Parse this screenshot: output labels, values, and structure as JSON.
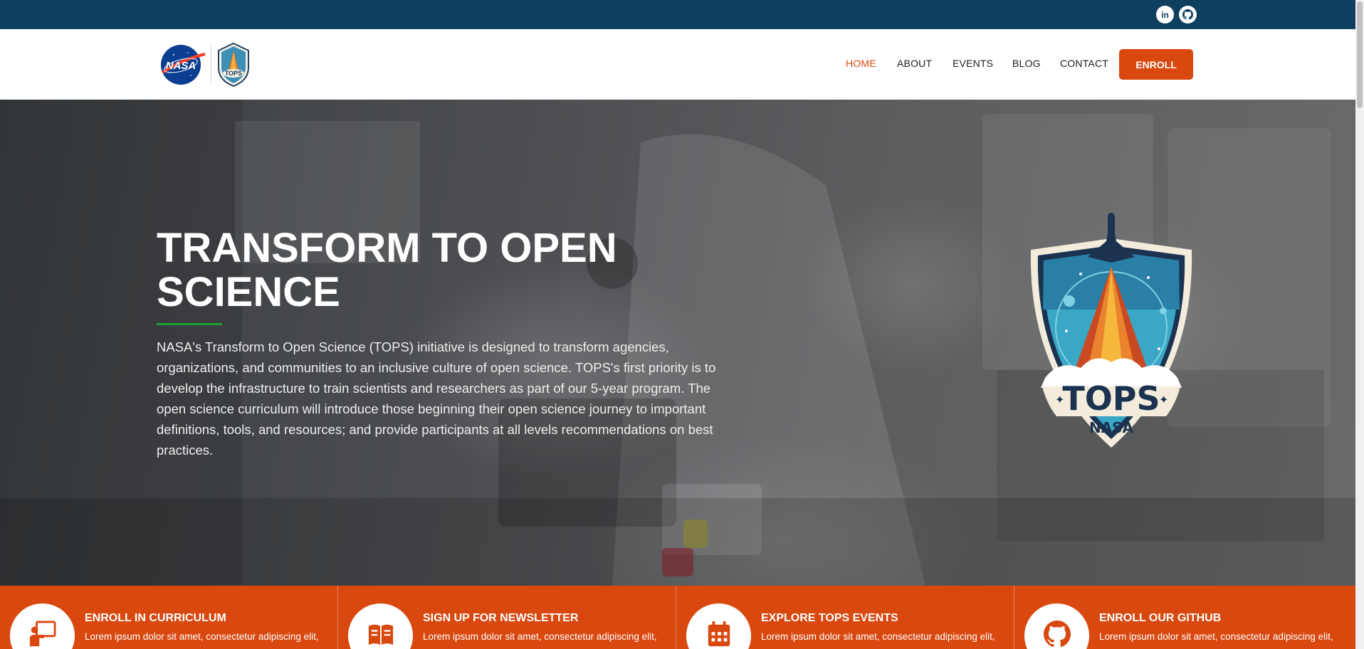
{
  "social": [
    {
      "name": "linkedin",
      "glyph": "in"
    },
    {
      "name": "github",
      "glyph": ""
    }
  ],
  "logos": {
    "nasa_text": "NASA",
    "tops_text": "TOPS"
  },
  "nav": {
    "items": [
      {
        "label": "HOME",
        "active": true
      },
      {
        "label": "ABOUT",
        "active": false
      },
      {
        "label": "EVENTS",
        "active": false
      },
      {
        "label": "BLOG",
        "active": false
      },
      {
        "label": "CONTACT",
        "active": false
      }
    ],
    "enroll_label": "ENROLL"
  },
  "hero": {
    "title": "TRANSFORM TO OPEN SCIENCE",
    "description": "NASA's Transform to Open Science (TOPS) initiative is designed to transform agencies, organizations, and communities to an inclusive culture of open science. TOPS's first priority is to develop the infrastructure to train scientists and researchers as part of our 5-year program. The open science curriculum will introduce those beginning their open science journey to important definitions, tools, and resources; and provide participants at all levels recommendations on best practices.",
    "badge_title": "TOPS",
    "badge_subtitle": "NASA"
  },
  "features": [
    {
      "title": "ENROLL IN CURRICULUM",
      "text": "Lorem ipsum dolor sit amet, consectetur adipiscing elit,",
      "icon": "teacher-icon"
    },
    {
      "title": "SIGN UP FOR NEWSLETTER",
      "text": "Lorem ipsum dolor sit amet, consectetur adipiscing elit,",
      "icon": "book-icon"
    },
    {
      "title": "EXPLORE TOPS EVENTS",
      "text": "Lorem ipsum dolor sit amet, consectetur adipiscing elit,",
      "icon": "calendar-icon"
    },
    {
      "title": "ENROLL OUR GITHUB",
      "text": "Lorem ipsum dolor sit amet, consectetur adipiscing elit,",
      "icon": "github-icon"
    }
  ],
  "colors": {
    "topbar": "#0e3f5e",
    "accent": "#d9480f",
    "green_underline": "#1e9e33"
  }
}
